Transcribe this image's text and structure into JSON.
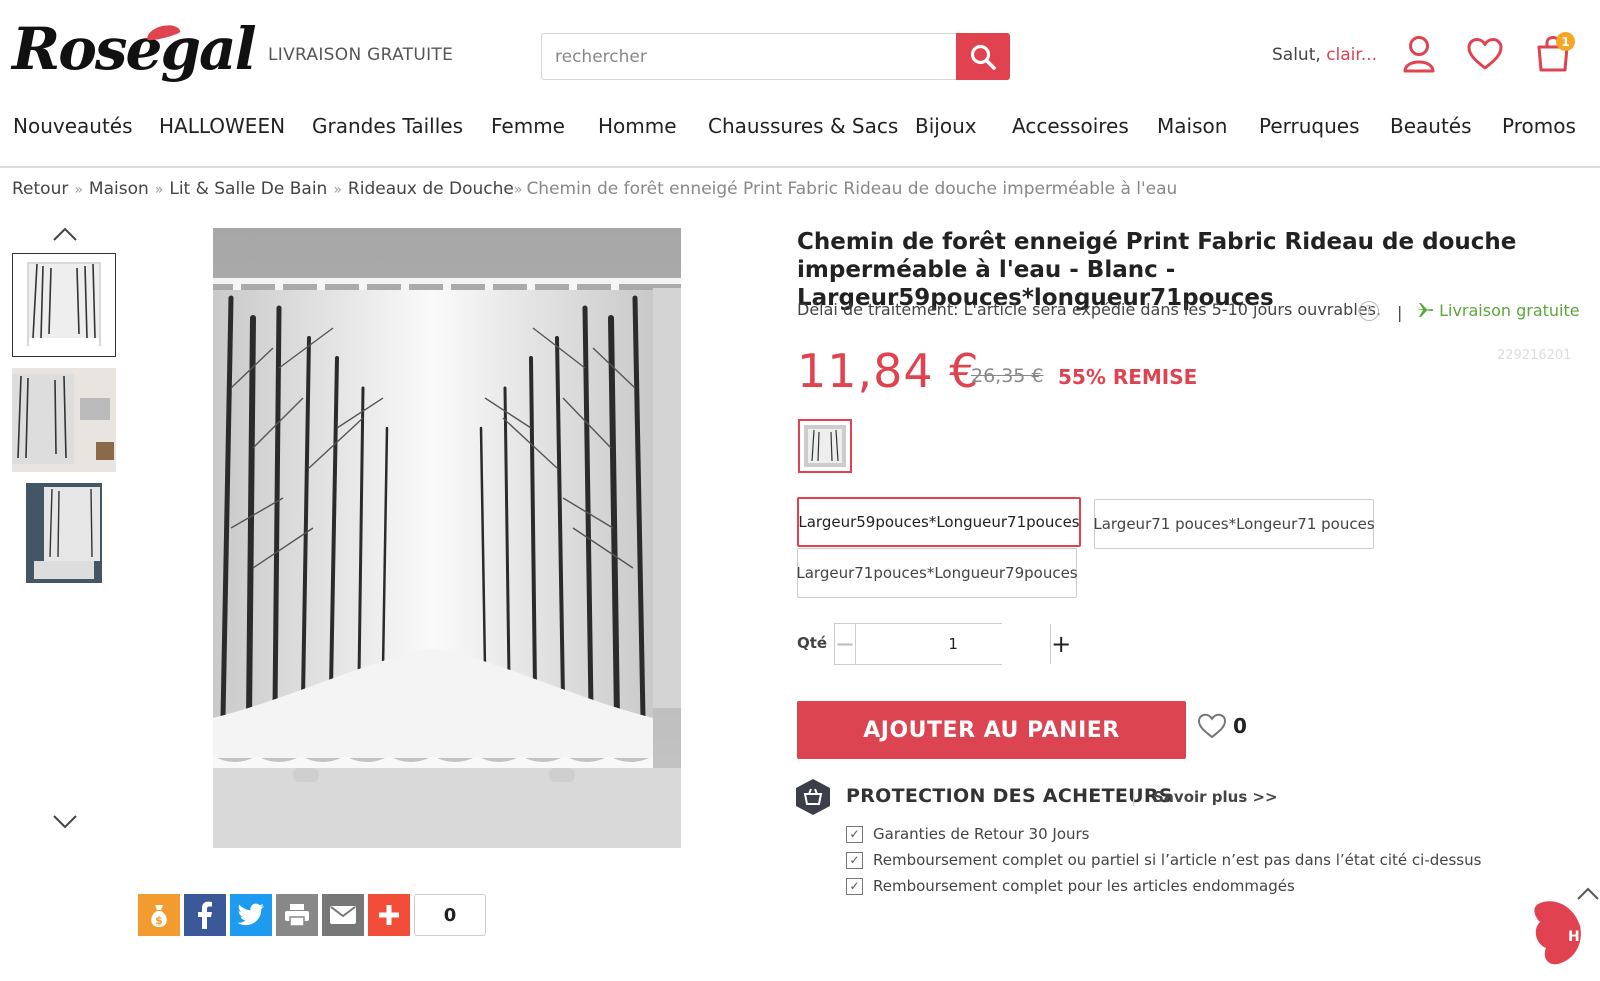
{
  "header": {
    "logo": "Rosegal",
    "free_shipping": "LIVRAISON GRATUITE",
    "search_placeholder": "rechercher",
    "greeting": "Salut,",
    "user_name": "clair...",
    "cart_count": "1"
  },
  "nav": [
    "Nouveautés",
    "HALLOWEEN",
    "Grandes Tailles",
    "Femme",
    "Homme",
    "Chaussures & Sacs",
    "Bijoux",
    "Accessoires",
    "Maison",
    "Perruques",
    "Beautés",
    "Promos"
  ],
  "breadcrumb": {
    "items": [
      "Retour",
      "Maison",
      "Lit & Salle De Bain",
      "Rideaux de Douche"
    ],
    "current": "Chemin de forêt enneigé Print Fabric Rideau de douche imperméable à l'eau"
  },
  "product": {
    "title": "Chemin de forêt enneigé Print Fabric Rideau de douche imperméable à l'eau - Blanc - Largeur59pouces*longueur71pouces",
    "delay_label": "Délai de traitement:",
    "delay_text": "L'article sera expédié dans les 5-10 jours ouvrables.",
    "divider": "|",
    "free_shipping": "Livraison gratuite",
    "sku": "229216201",
    "price": "11,84 €",
    "old_price": "26,35 €",
    "discount": "55% REMISE",
    "sizes": [
      "Largeur59pouces*Longueur71pouces",
      "Largeur71 pouces*Longeur71 pouces",
      "Largeur71pouces*Longueur79pouces"
    ],
    "qty_label": "Qté",
    "qty_value": "1",
    "add_to_cart": "AJOUTER AU PANIER",
    "wish_count": "0"
  },
  "protection": {
    "title": "PROTECTION DES ACHETEURS",
    "separator": "|",
    "more": "Savoir plus >>",
    "items": [
      "Garanties de Retour 30 Jours",
      "Remboursement complet ou partiel si l’article n’est pas dans l’état cité ci-dessus",
      "Remboursement complet pour les articles endommagés"
    ]
  },
  "share": {
    "count": "0"
  },
  "back_top": "HAU",
  "colors": {
    "accent": "#e0424f",
    "green": "#5aa83a",
    "badge": "#f6a623"
  }
}
